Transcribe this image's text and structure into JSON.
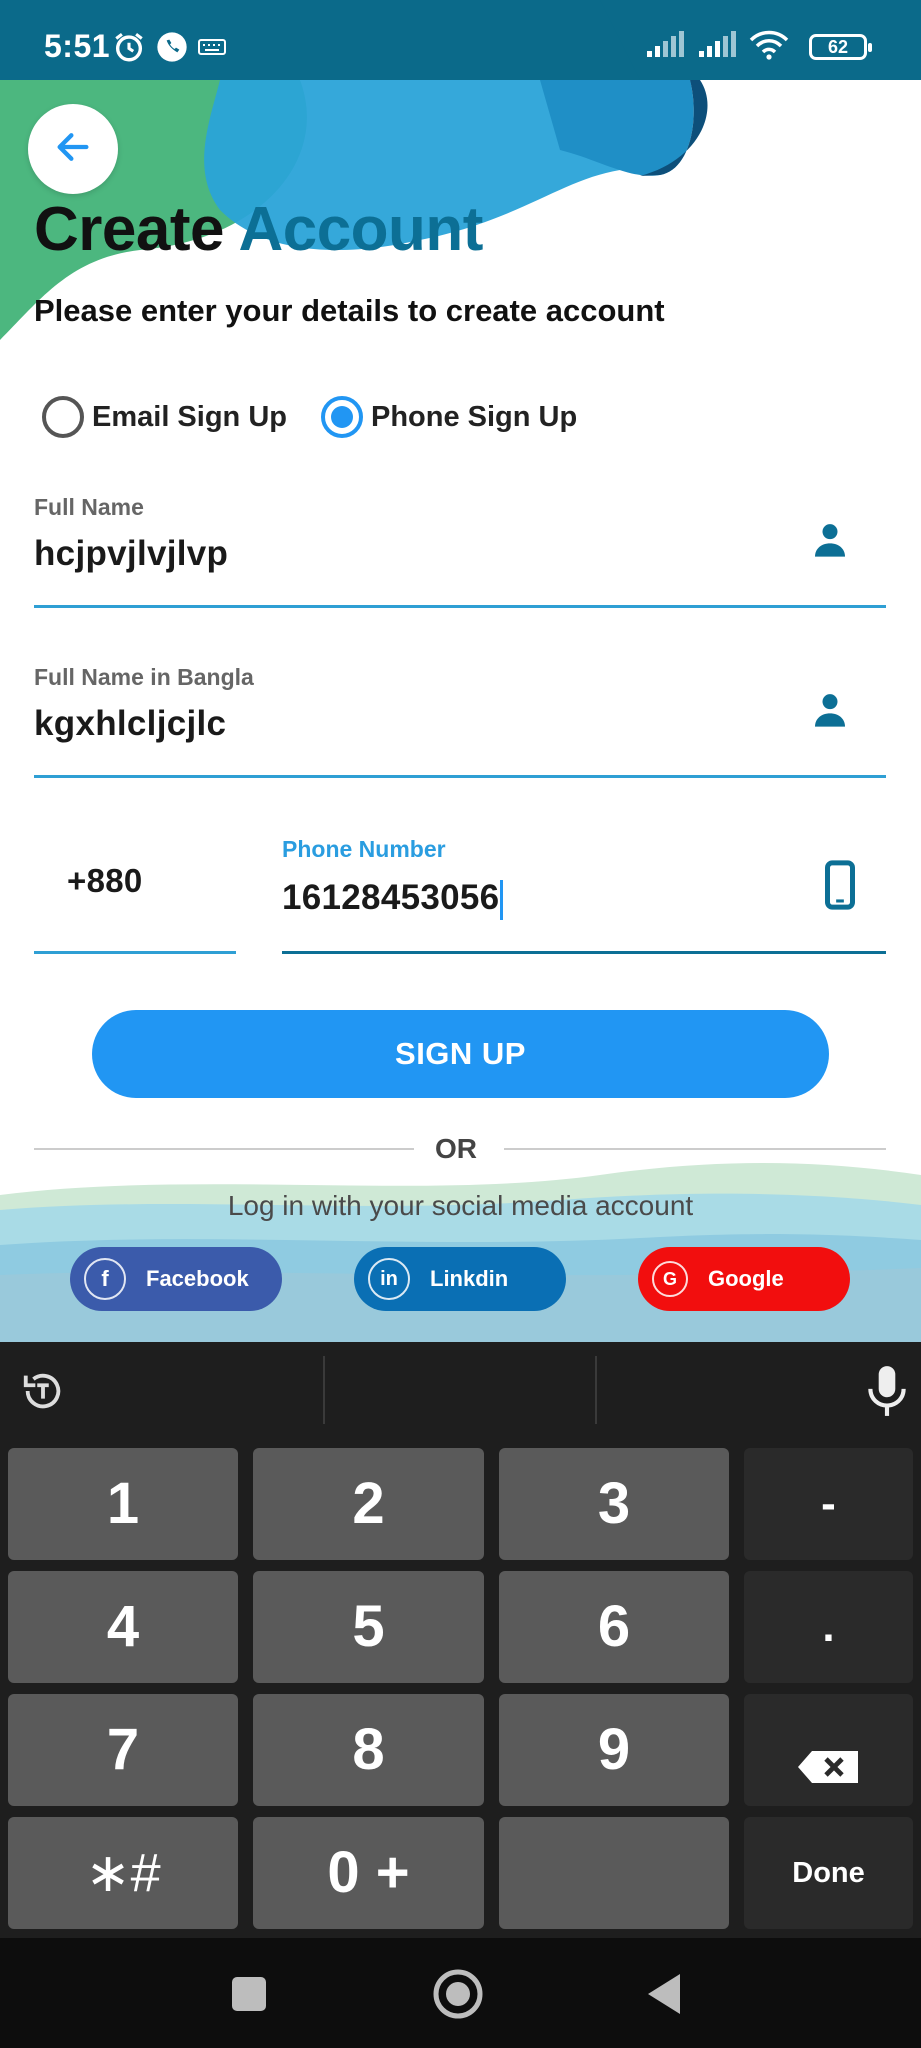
{
  "status_bar": {
    "time": "5:51",
    "battery": "62",
    "icons": [
      "alarm-icon",
      "phone-call-icon",
      "keyboard-icon",
      "signal-icon",
      "signal-icon",
      "wifi-icon",
      "battery-icon"
    ]
  },
  "header": {
    "title_part1": "Create",
    "title_part2": "Account",
    "subtitle": "Please enter your details to create account"
  },
  "signup_mode": {
    "options": [
      "Email Sign Up",
      "Phone Sign Up"
    ],
    "selected": "Phone Sign Up"
  },
  "form": {
    "full_name_label": "Full Name",
    "full_name_value": "hcjpvjlvjlvp",
    "full_name_bangla_label": "Full Name in Bangla",
    "full_name_bangla_value": "kgxhlcljcjlc",
    "country_code": "+880",
    "phone_label": "Phone Number",
    "phone_value": "16128453056"
  },
  "signup_button": "SIGN UP",
  "or_text": "OR",
  "social": {
    "prompt": "Log in with your social media account",
    "buttons": [
      {
        "label": "Facebook",
        "icon": "f",
        "color": "#3b5bab"
      },
      {
        "label": "Linkdin",
        "icon": "in",
        "color": "#0a6fb4"
      },
      {
        "label": "Google",
        "icon": "G",
        "color": "#f20e0e"
      }
    ]
  },
  "keyboard": {
    "keys": [
      [
        "1",
        "2",
        "3",
        "-"
      ],
      [
        "4",
        "5",
        "6",
        "."
      ],
      [
        "7",
        "8",
        "9",
        ""
      ],
      [
        "∗#",
        "0 +",
        "",
        "Done"
      ]
    ]
  },
  "colors": {
    "accent": "#2196f3",
    "title_accent": "#0c6f95",
    "field_underline": "#2f9fd4"
  }
}
